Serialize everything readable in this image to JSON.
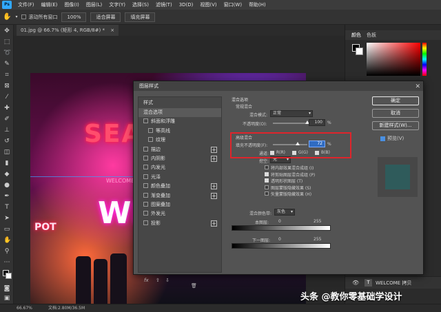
{
  "menu": [
    "文件(F)",
    "编辑(E)",
    "图像(I)",
    "图层(L)",
    "文字(Y)",
    "选择(S)",
    "滤镜(T)",
    "3D(D)",
    "视图(V)",
    "窗口(W)",
    "帮助(H)"
  ],
  "app_logo": "Ps",
  "options": {
    "scroll_all": "滚动所有窗口",
    "zoom": "100%",
    "fit_screen": "适合屏幕",
    "fill_screen": "填充屏幕"
  },
  "document_tab": "01.jpg @ 66.7% (矩形 4, RGB/8#) *",
  "canvas_text": {
    "sea": "SEA",
    "we": "WE",
    "welcome_small": "WELCOME TO",
    "pot": "POT"
  },
  "right_panel": {
    "tab_color": "颜色",
    "tab_swatches": "色板",
    "layer_name": "WELCOME 拷贝"
  },
  "status": {
    "zoom": "66.67%",
    "doc": "文档:2.80M/36.5M"
  },
  "watermark": "头条 @教你零基础学设计",
  "dialog": {
    "title": "图层样式",
    "styles_header": "样式",
    "styles": [
      {
        "label": "混合选项",
        "check": false,
        "plus": false,
        "sel": true
      },
      {
        "label": "斜面和浮雕",
        "check": true,
        "plus": false
      },
      {
        "label": "等高线",
        "check": true,
        "plus": false,
        "indent": true
      },
      {
        "label": "纹理",
        "check": true,
        "plus": false,
        "indent": true
      },
      {
        "label": "描边",
        "check": true,
        "plus": true
      },
      {
        "label": "内阴影",
        "check": true,
        "plus": true
      },
      {
        "label": "内发光",
        "check": true,
        "plus": false
      },
      {
        "label": "光泽",
        "check": true,
        "plus": false
      },
      {
        "label": "颜色叠加",
        "check": true,
        "plus": true
      },
      {
        "label": "渐变叠加",
        "check": true,
        "plus": true
      },
      {
        "label": "图案叠加",
        "check": true,
        "plus": false
      },
      {
        "label": "外发光",
        "check": true,
        "plus": false
      },
      {
        "label": "投影",
        "check": true,
        "plus": true
      }
    ],
    "blend_section": "混合选项",
    "general_blending": "常规混合",
    "blend_mode_label": "混合模式:",
    "blend_mode_value": "正常",
    "opacity_label": "不透明度(O):",
    "opacity_value": "100",
    "opacity_level": 1.0,
    "percent": "%",
    "advanced_blending": "高级混合",
    "fill_opacity_label": "填充不透明度(F):",
    "fill_opacity_value": "72",
    "fill_opacity_level": 0.72,
    "channels_label": "通道:",
    "channel_r": "R(R)",
    "channel_g": "G(G)",
    "channel_b": "B(B)",
    "knockout_label": "挖空:",
    "knockout_value": "无",
    "options": [
      {
        "label": "将内部效果混合成组 (I)",
        "on": false
      },
      {
        "label": "将剪贴图层混合成组 (P)",
        "on": true
      },
      {
        "label": "透明形状图层 (T)",
        "on": true
      },
      {
        "label": "图层蒙版隐藏效果 (S)",
        "on": false
      },
      {
        "label": "矢量蒙版隐藏效果 (H)",
        "on": false
      }
    ],
    "blend_if_label": "混合颜色带:",
    "blend_if_value": "灰色",
    "this_layer": "本图层:",
    "underlying": "下一图层:",
    "min_value": "0",
    "max_value": "255",
    "buttons": {
      "ok": "确定",
      "cancel": "取消",
      "new_style": "新建样式(W)...",
      "preview": "预览(V)"
    },
    "footer_fx": "fx"
  },
  "colors": {
    "accent_red": "#e0242b",
    "highlight_blue": "#2f6bc2",
    "ps_blue": "#31a8ff"
  }
}
